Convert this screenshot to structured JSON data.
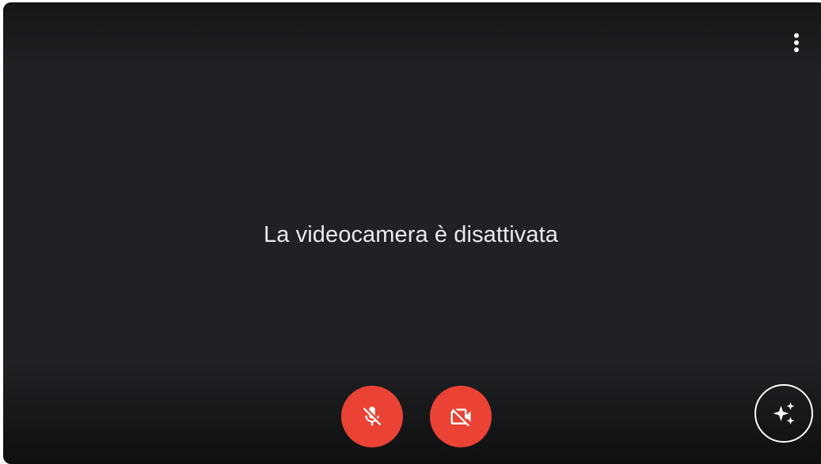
{
  "preview": {
    "status_text": "La videocamera è disattivata",
    "background_color": "#202124"
  },
  "controls": {
    "more_options": {
      "icon": "more-vert-icon"
    },
    "microphone": {
      "state": "off",
      "icon": "mic-off-icon",
      "color": "#ea4335"
    },
    "camera": {
      "state": "off",
      "icon": "videocam-off-icon",
      "color": "#ea4335"
    },
    "effects": {
      "icon": "sparkle-icon"
    }
  }
}
